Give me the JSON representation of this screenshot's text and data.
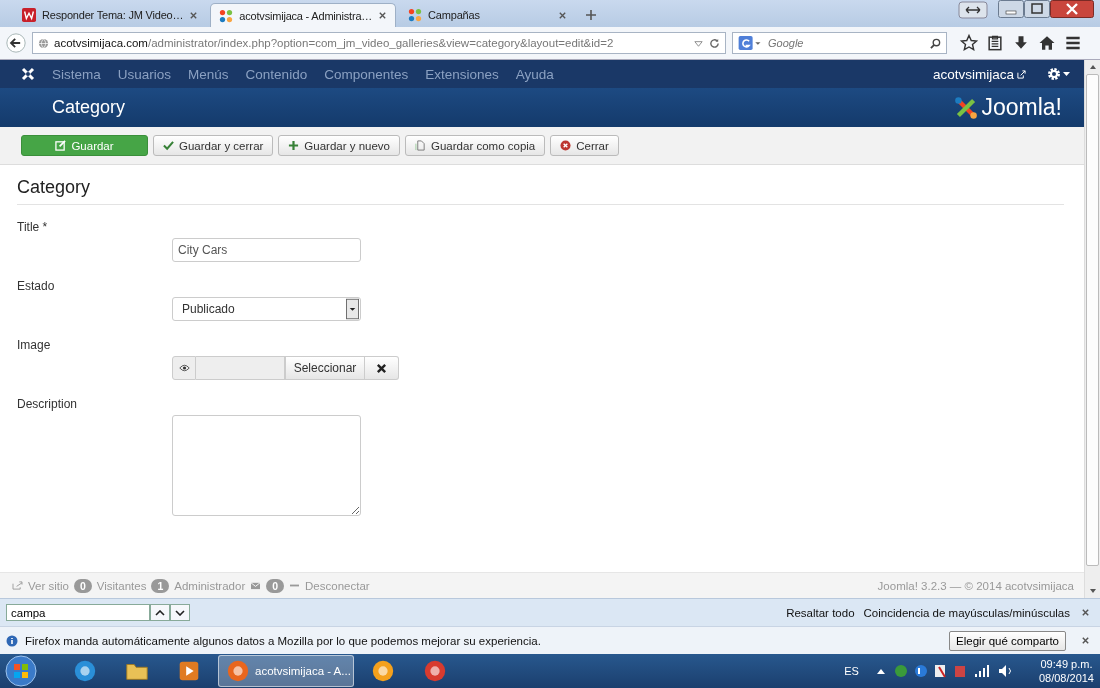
{
  "browser": {
    "tabs": [
      {
        "title": "Responder Tema: JM Video…",
        "selected": false,
        "kind": "forum"
      },
      {
        "title": "acotvsimijaca - Administra…",
        "selected": true,
        "kind": "joomla"
      },
      {
        "title": "Campañas",
        "selected": false,
        "kind": "joomla"
      }
    ],
    "url": {
      "host": "acotvsimijaca.com",
      "path": "/administrator/index.php?option=com_jm_video_galleries&view=category&layout=edit&id=2"
    },
    "search": {
      "placeholder": "Google"
    }
  },
  "admin": {
    "menu": [
      "Sistema",
      "Usuarios",
      "Menús",
      "Contenido",
      "Componentes",
      "Extensiones",
      "Ayuda"
    ],
    "user": "acotvsimijaca",
    "page_title": "Category",
    "logo": "Joomla!",
    "toolbar": [
      {
        "label": "Guardar",
        "kind": "save"
      },
      {
        "label": "Guardar y cerrar",
        "kind": "check"
      },
      {
        "label": "Guardar y nuevo",
        "kind": "plus"
      },
      {
        "label": "Guardar como copia",
        "kind": "copy"
      },
      {
        "label": "Cerrar",
        "kind": "close"
      }
    ],
    "form": {
      "heading": "Category",
      "fields": [
        {
          "label": "Title *",
          "kind": "text",
          "value": "City Cars"
        },
        {
          "label": "Estado",
          "kind": "select",
          "value": "Publicado"
        },
        {
          "label": "Image",
          "kind": "media",
          "button": "Seleccionar"
        },
        {
          "label": "Description",
          "kind": "textarea"
        }
      ]
    },
    "footer": {
      "view_site": "Ver sitio",
      "visitors_count": "0",
      "visitors": "Visitantes",
      "admins_count": "1",
      "admins": "Administrador",
      "messages_count": "0",
      "logout": "Desconectar",
      "copyright": "Joomla! 3.2.3 — © 2014 acotvsimijaca"
    }
  },
  "findbar": {
    "value": "campa",
    "highlight": "Resaltar todo",
    "match_case": "Coincidencia de mayúsculas/minúsculas"
  },
  "notification": {
    "text": "Firefox manda automáticamente algunos datos a Mozilla por lo que podemos mejorar su experiencia.",
    "button": "Elegir qué comparto"
  },
  "taskbar": {
    "apps": [
      {
        "kind": "ie",
        "selected": false
      },
      {
        "kind": "folder",
        "selected": false
      },
      {
        "kind": "media",
        "selected": false
      },
      {
        "kind": "firefox",
        "selected": true,
        "label": "acotvsimijaca - A..."
      },
      {
        "kind": "orange",
        "selected": false
      },
      {
        "kind": "chrome",
        "selected": false
      }
    ],
    "language": "ES",
    "time": "09:49 p.m.",
    "date": "08/08/2014"
  }
}
